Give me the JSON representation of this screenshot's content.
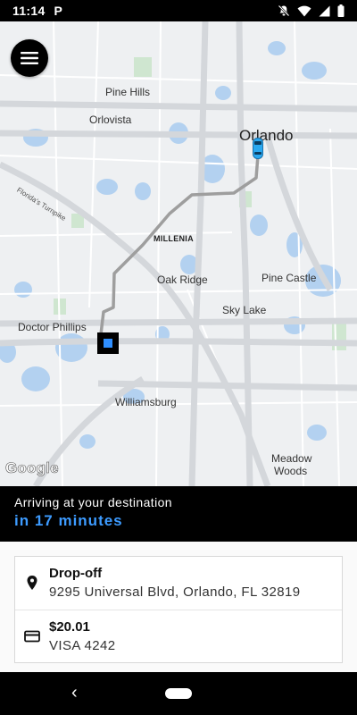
{
  "status_bar": {
    "time": "11:14",
    "app_badge": "P",
    "icons": [
      "notifications-off-icon",
      "wifi-icon",
      "signal-icon",
      "battery-icon"
    ]
  },
  "map": {
    "places": {
      "pine_hills": "Pine Hills",
      "orlovista": "Orlovista",
      "orlando": "Orlando",
      "turnpike": "Florida's Turnpike",
      "millenia": "MILLENIA",
      "oak_ridge": "Oak Ridge",
      "pine_castle": "Pine Castle",
      "sky_lake": "Sky Lake",
      "doctor_phillips": "Doctor Phillips",
      "williamsburg": "Williamsburg",
      "meadow": "Meadow",
      "woods": "Woods"
    },
    "attribution": "Google",
    "route_color": "#9e9e9e",
    "car_color": "#29a8f0",
    "destination_color": "#2f8fff"
  },
  "eta": {
    "line1": "Arriving at your destination",
    "line2": "in 17 minutes"
  },
  "dropoff": {
    "title": "Drop-off",
    "address": "9295 Universal Blvd, Orlando, FL 32819"
  },
  "payment": {
    "amount": "$20.01",
    "method": "VISA 4242"
  },
  "nav": {
    "back": "‹"
  }
}
